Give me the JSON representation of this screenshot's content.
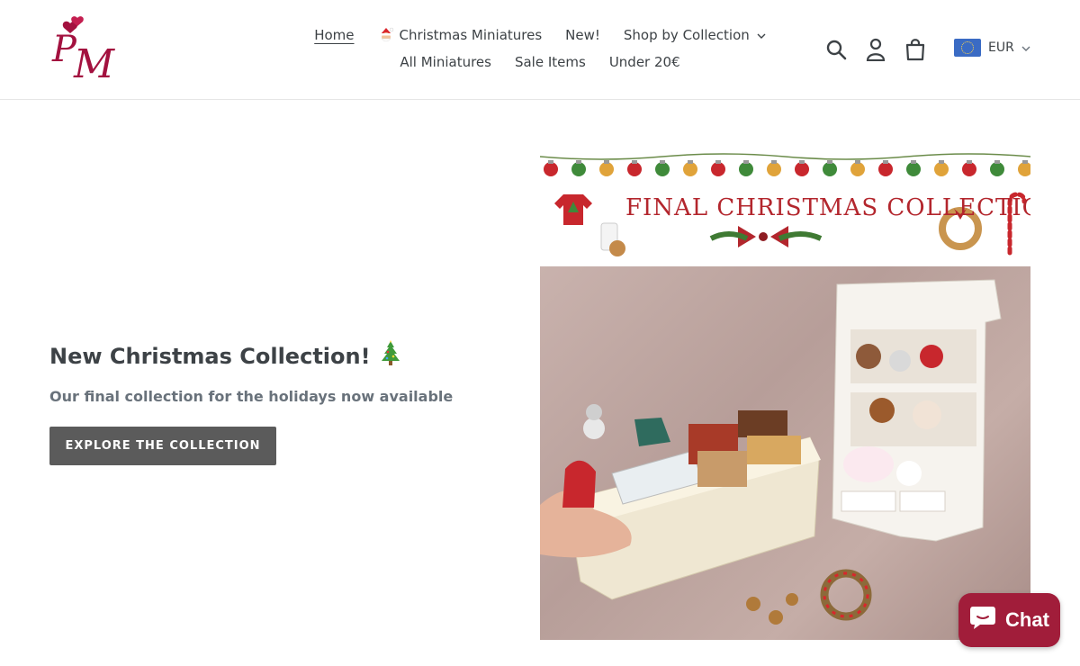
{
  "header": {
    "logo_text": "PM",
    "nav_row1": [
      {
        "label": "Home",
        "active": true
      },
      {
        "label": "Christmas Miniatures",
        "icon": "santa-icon"
      },
      {
        "label": "New!"
      },
      {
        "label": "Shop by Collection",
        "icon": "chevron-down-icon"
      }
    ],
    "nav_row2": [
      {
        "label": "All Miniatures"
      },
      {
        "label": "Sale Items"
      },
      {
        "label": "Under 20€"
      }
    ],
    "icons": [
      "search-icon",
      "account-icon",
      "cart-icon"
    ],
    "currency": {
      "code": "EUR",
      "flag": "eu-flag-icon"
    }
  },
  "hero": {
    "title": "New Christmas Collection!",
    "title_icon": "christmas-tree-icon",
    "subtitle": "Our final collection for the holidays now available",
    "button_label": "EXPLORE THE COLLECTION"
  },
  "banner": {
    "title": "FINAL CHRISTMAS COLLECTION"
  },
  "chat": {
    "label": "Chat",
    "icon": "chat-bubble-icon"
  },
  "colors": {
    "accent": "#a11d3a",
    "button": "#5b5b5b",
    "banner_red": "#b3262d"
  }
}
